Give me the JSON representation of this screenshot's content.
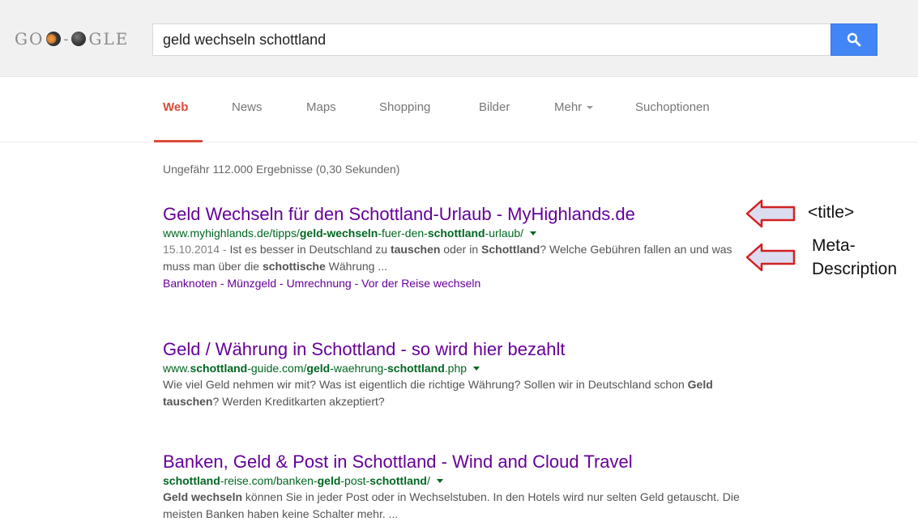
{
  "header": {
    "logo_text_left": "GO",
    "logo_text_right": "GLE",
    "logo_dash": "-",
    "search_value": "geld wechseln schottland"
  },
  "tabs": [
    {
      "label": "Web",
      "active": true
    },
    {
      "label": "News"
    },
    {
      "label": "Maps"
    },
    {
      "label": "Shopping"
    },
    {
      "label": "Bilder"
    },
    {
      "label": "Mehr"
    },
    {
      "label": "Suchoptionen"
    }
  ],
  "stats": "Ungefähr 112.000 Ergebnisse (0,30 Sekunden)",
  "results": [
    {
      "title": "Geld Wechseln für den Schottland-Urlaub - MyHighlands.de",
      "url": {
        "p1": "www.myhighlands.de/tipps/",
        "b1": "geld-wechseln",
        "p2": "-fuer-den-",
        "b2": "schottland",
        "p3": "-urlaub/"
      },
      "snippet": {
        "date": "15.10.2014 - ",
        "t1": "Ist es besser in Deutschland zu ",
        "b1": "tauschen",
        "t2": " oder in ",
        "b2": "Schottland",
        "t3": "? Welche Gebühren fallen an und was muss man über die ",
        "b3": "schottische",
        "t4": " Währung ..."
      },
      "sitelinks": [
        "Banknoten",
        "Münzgeld",
        "Umrechnung",
        "Vor der Reise wechseln"
      ],
      "sitelink_separator": " - "
    },
    {
      "title": "Geld / Währung in Schottland - so wird hier bezahlt",
      "url": {
        "p1": "www.",
        "b1": "schottland",
        "p2": "-guide.com/",
        "b2": "geld",
        "p3": "-waehrung-",
        "b3": "schottland",
        "p4": ".php"
      },
      "snippet": {
        "t1": "Wie viel Geld nehmen wir mit? Was ist eigentlich die richtige Währung? Sollen wir in Deutschland schon ",
        "b1": "Geld tauschen",
        "t2": "? Werden Kreditkarten akzeptiert?"
      }
    },
    {
      "title": "Banken, Geld & Post in Schottland - Wind and Cloud Travel",
      "url": {
        "b1": "schottland",
        "p1": "-reise.com/banken-",
        "b2": "geld",
        "p2": "-post-",
        "b3": "schottland",
        "p3": "/"
      },
      "snippet": {
        "b1": "Geld wechseln",
        "t1": " können Sie in jeder Post oder in Wechselstuben. In den Hotels wird nur selten Geld getauscht. Die meisten Banken haben keine Schalter mehr. ..."
      }
    }
  ],
  "annotations": {
    "title_label": "<title>",
    "meta_label_line1": "Meta-",
    "meta_label_line2": "Description",
    "arrow_fill": "#dcdcf0",
    "arrow_stroke": "#d22020"
  },
  "colors": {
    "search_button": "#4285f4",
    "active_tab": "#dd4b39",
    "title_link": "#660099",
    "url": "#006621"
  },
  "icons": {
    "search_button_icon": "search-icon",
    "more_caret": "chevron-down-icon",
    "url_caret": "caret-down-icon",
    "annotation_arrow": "left-arrow-icon"
  }
}
